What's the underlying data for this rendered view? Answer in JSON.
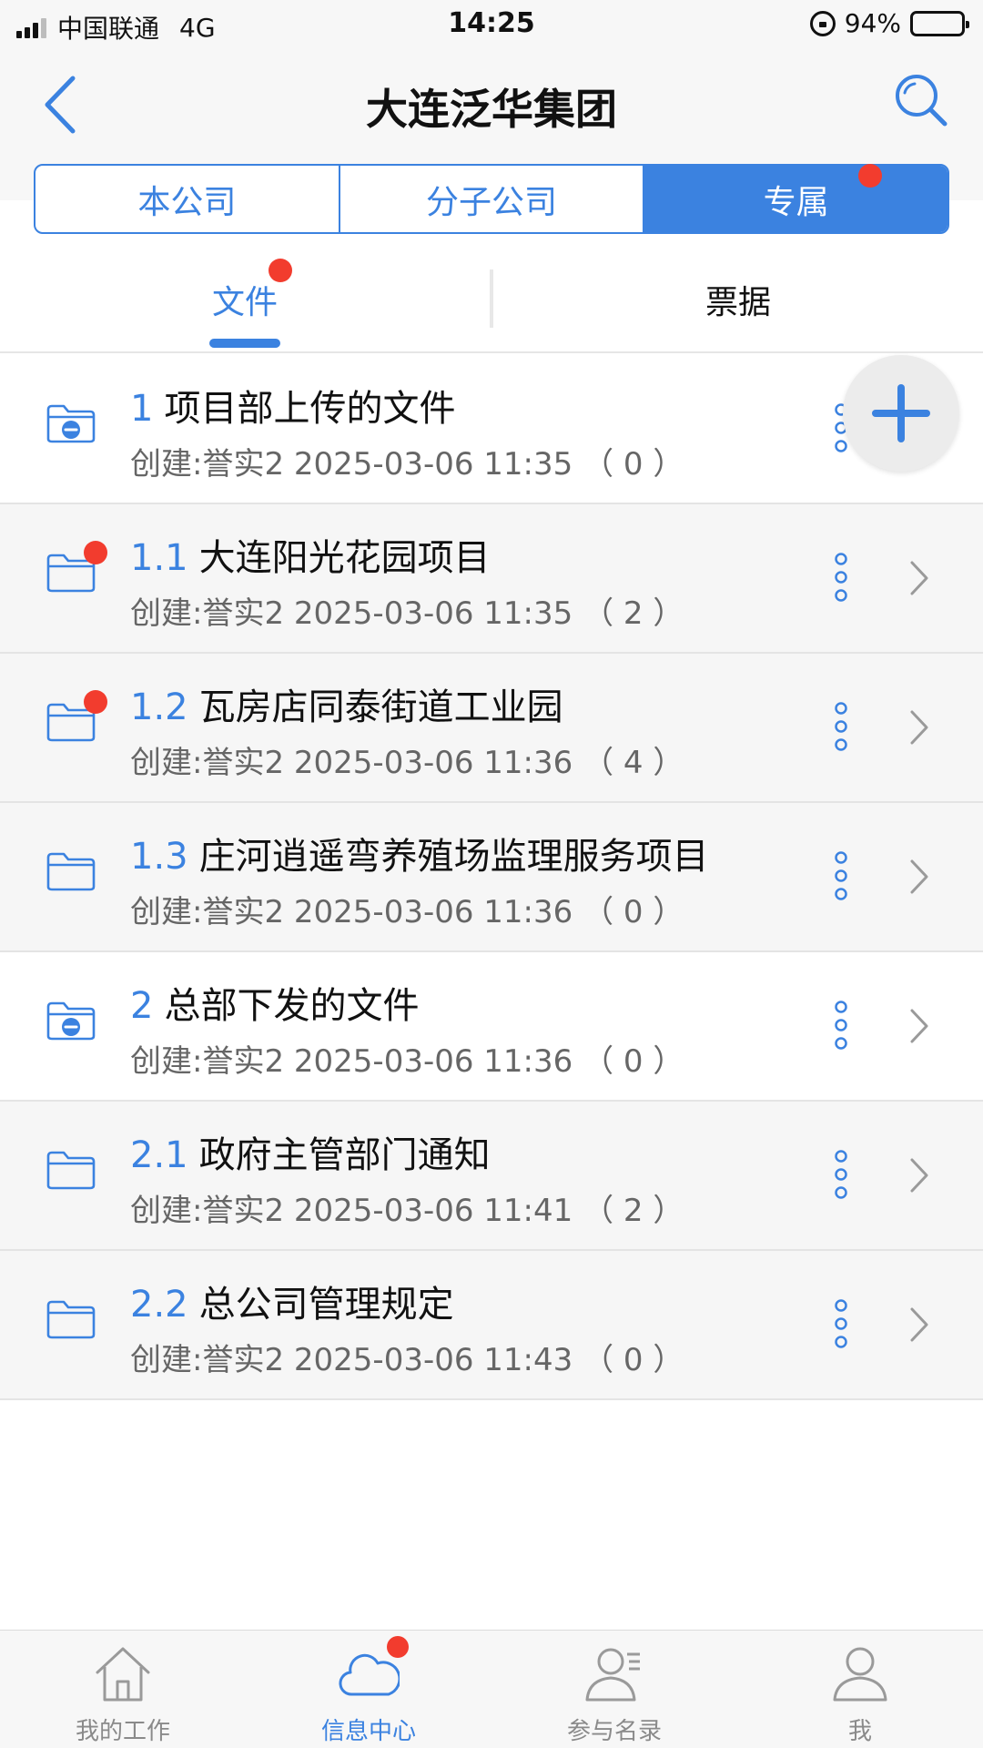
{
  "status_bar": {
    "carrier": "中国联通",
    "network": "4G",
    "time": "14:25",
    "battery": "94%",
    "battery_level": 0.94
  },
  "header": {
    "title": "大连泛华集团"
  },
  "segments": [
    {
      "label": "本公司",
      "active": false,
      "badge": false
    },
    {
      "label": "分子公司",
      "active": false,
      "badge": false
    },
    {
      "label": "专属",
      "active": true,
      "badge": true
    }
  ],
  "sub_tabs": [
    {
      "label": "文件",
      "active": true,
      "badge": true
    },
    {
      "label": "票据",
      "active": false,
      "badge": false
    }
  ],
  "rows": [
    {
      "num": "1",
      "title": "项目部上传的文件",
      "meta": "创建:誉实2 2025-03-06 11:35 （ 0 ）",
      "icon": "shared-folder-icon",
      "badge": false,
      "bg": "white"
    },
    {
      "num": "1.1",
      "title": "大连阳光花园项目",
      "meta": "创建:誉实2 2025-03-06 11:35 （ 2 ）",
      "icon": "folder-icon",
      "badge": true,
      "bg": "grey"
    },
    {
      "num": "1.2",
      "title": "瓦房店同泰街道工业园",
      "meta": "创建:誉实2 2025-03-06 11:36 （ 4 ）",
      "icon": "folder-icon",
      "badge": true,
      "bg": "grey"
    },
    {
      "num": "1.3",
      "title": "庄河逍遥弯养殖场监理服务项目",
      "meta": "创建:誉实2 2025-03-06 11:36 （ 0 ）",
      "icon": "folder-icon",
      "badge": false,
      "bg": "grey"
    },
    {
      "num": "2",
      "title": "总部下发的文件",
      "meta": "创建:誉实2 2025-03-06 11:36 （ 0 ）",
      "icon": "shared-folder-icon",
      "badge": false,
      "bg": "white"
    },
    {
      "num": "2.1",
      "title": "政府主管部门通知",
      "meta": "创建:誉实2 2025-03-06 11:41 （ 2 ）",
      "icon": "folder-icon",
      "badge": false,
      "bg": "grey"
    },
    {
      "num": "2.2",
      "title": "总公司管理规定",
      "meta": "创建:誉实2 2025-03-06 11:43 （ 0 ）",
      "icon": "folder-icon",
      "badge": false,
      "bg": "grey"
    }
  ],
  "tab_bar": [
    {
      "label": "我的工作",
      "icon": "home-icon",
      "active": false,
      "badge": false
    },
    {
      "label": "信息中心",
      "icon": "cloud-icon",
      "active": true,
      "badge": true
    },
    {
      "label": "参与名录",
      "icon": "contacts-icon",
      "active": false,
      "badge": false
    },
    {
      "label": "我",
      "icon": "profile-icon",
      "active": false,
      "badge": false
    }
  ],
  "colors": {
    "accent": "#3b82e0",
    "badge": "#f23c2e",
    "text": "#111111",
    "muted": "#666666"
  }
}
